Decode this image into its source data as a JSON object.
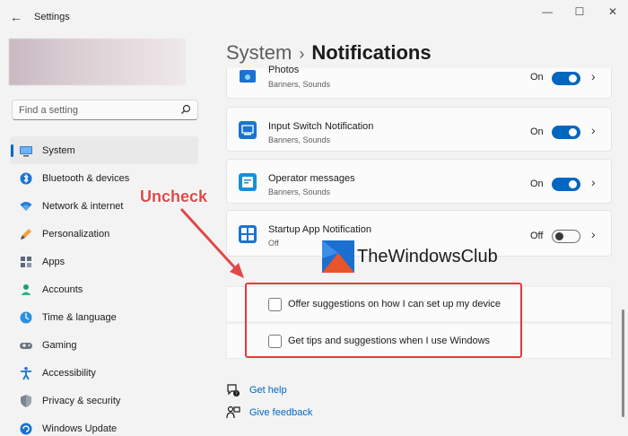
{
  "window": {
    "title": "Settings",
    "back_glyph": "←",
    "minimize_glyph": "—",
    "maximize_glyph": "☐",
    "close_glyph": "✕"
  },
  "search": {
    "placeholder": "Find a setting"
  },
  "sidebar": {
    "items": [
      {
        "label": "System",
        "icon": "monitor-icon",
        "active": true
      },
      {
        "label": "Bluetooth & devices",
        "icon": "bluetooth-icon"
      },
      {
        "label": "Network & internet",
        "icon": "wifi-icon"
      },
      {
        "label": "Personalization",
        "icon": "brush-icon"
      },
      {
        "label": "Apps",
        "icon": "apps-icon"
      },
      {
        "label": "Accounts",
        "icon": "person-icon"
      },
      {
        "label": "Time & language",
        "icon": "globe-clock-icon"
      },
      {
        "label": "Gaming",
        "icon": "gamepad-icon"
      },
      {
        "label": "Accessibility",
        "icon": "accessibility-icon"
      },
      {
        "label": "Privacy & security",
        "icon": "shield-icon"
      },
      {
        "label": "Windows Update",
        "icon": "update-icon"
      }
    ]
  },
  "header": {
    "crumb": "System",
    "separator": "›",
    "current": "Notifications"
  },
  "apps": [
    {
      "name": "Photos",
      "detail": "Banners, Sounds",
      "state": "On",
      "on": true,
      "icon": "photos-icon"
    },
    {
      "name": "Input Switch Notification",
      "detail": "Banners, Sounds",
      "state": "On",
      "on": true,
      "icon": "input-switch-icon"
    },
    {
      "name": "Operator messages",
      "detail": "Banners, Sounds",
      "state": "On",
      "on": true,
      "icon": "operator-messages-icon"
    },
    {
      "name": "Startup App Notification",
      "detail": "Off",
      "state": "Off",
      "on": false,
      "icon": "startup-app-icon"
    }
  ],
  "chevron_glyph": "›",
  "options": [
    {
      "label": "Offer suggestions on how I can set up my device",
      "checked": false
    },
    {
      "label": "Get tips and suggestions when I use Windows",
      "checked": false
    }
  ],
  "annotation": {
    "text": "Uncheck",
    "color": "#e04848"
  },
  "watermark": {
    "text": "TheWindowsClub"
  },
  "help": {
    "get_help": "Get help",
    "give_feedback": "Give feedback"
  },
  "colors": {
    "accent": "#0067c0",
    "highlight": "#e03c3c"
  }
}
